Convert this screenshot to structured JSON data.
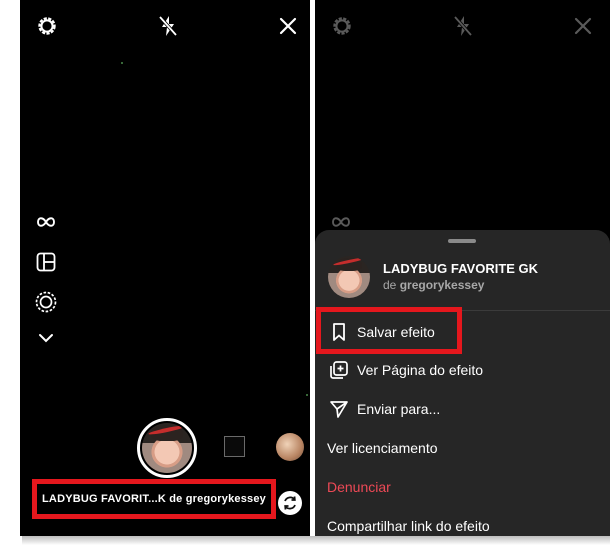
{
  "left_screen": {
    "top_bar": {
      "settings_icon": "gear-icon",
      "flash_icon": "flash-off-icon",
      "close_icon": "close-icon"
    },
    "side_tools": [
      "boomerang-icon",
      "layout-icon",
      "multi-capture-icon",
      "chevron-down-icon"
    ],
    "effect_caption": "LADYBUG FAVORIT...K de gregorykessey"
  },
  "right_screen": {
    "sheet": {
      "effect_name": "LADYBUG FAVORITE GK",
      "author_prefix": "de",
      "author": "gregorykessey",
      "menu": [
        {
          "label": "Salvar efeito",
          "icon": "bookmark-icon"
        },
        {
          "label": "Ver Página do efeito",
          "icon": "effect-page-icon"
        },
        {
          "label": "Enviar para...",
          "icon": "send-icon"
        },
        {
          "label": "Ver licenciamento"
        },
        {
          "label": "Denunciar"
        },
        {
          "label": "Compartilhar link do efeito"
        }
      ]
    }
  },
  "colors": {
    "background": "#000000",
    "sheet": "#262626",
    "highlight": "#e5171d",
    "danger": "#ed4956",
    "muted_text": "#a8a8a8"
  }
}
